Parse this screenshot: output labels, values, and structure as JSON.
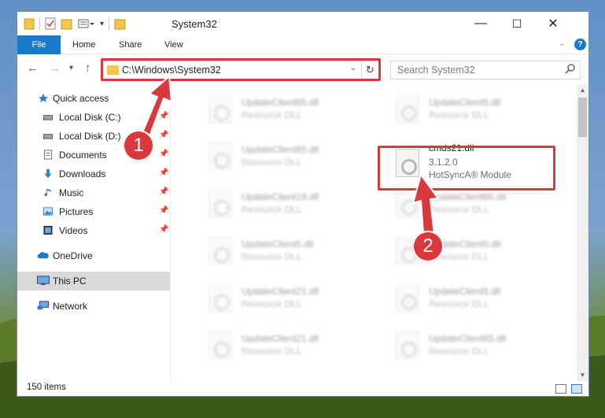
{
  "window": {
    "title": "System32",
    "minimize": "—",
    "maximize": "☐",
    "close": "✕"
  },
  "ribbon": {
    "tabs": [
      "File",
      "Home",
      "Share",
      "View"
    ],
    "help": "?"
  },
  "navigation": {
    "address": "C:\\Windows\\System32",
    "search_placeholder": "Search System32"
  },
  "sidebar": {
    "items": [
      {
        "label": "Quick access",
        "icon": "star-icon"
      },
      {
        "label": "Local Disk (C:)",
        "icon": "drive-icon",
        "pinned": true
      },
      {
        "label": "Local Disk (D:)",
        "icon": "drive-icon",
        "pinned": true
      },
      {
        "label": "Documents",
        "icon": "documents-icon",
        "pinned": true
      },
      {
        "label": "Downloads",
        "icon": "download-icon",
        "pinned": true
      },
      {
        "label": "Music",
        "icon": "music-icon",
        "pinned": true
      },
      {
        "label": "Pictures",
        "icon": "pictures-icon",
        "pinned": true
      },
      {
        "label": "Videos",
        "icon": "videos-icon",
        "pinned": true
      },
      {
        "label": "OneDrive",
        "icon": "cloud-icon"
      },
      {
        "label": "This PC",
        "icon": "computer-icon",
        "selected": true
      },
      {
        "label": "Network",
        "icon": "network-icon"
      }
    ]
  },
  "files": {
    "left_column": [
      {
        "name": "UpdateClient65.dll",
        "type": "Resource DLL"
      },
      {
        "name": "UpdateClient65.dll",
        "type": "Resource DLL"
      },
      {
        "name": "UpdateClient19.dll",
        "type": "Resource DLL"
      },
      {
        "name": "UpdateClient5.dll",
        "type": "Resource DLL"
      },
      {
        "name": "UpdateClient21.dll",
        "type": "Resource DLL"
      },
      {
        "name": "UpdateClient21.dll",
        "type": "Resource DLL"
      }
    ],
    "right_column": [
      {
        "name": "UpdateClient5.dll",
        "type": "Resource DLL"
      },
      {
        "name": "cmds21.dll",
        "version": "3.1.2.0",
        "type": "HotSyncA® Module",
        "highlighted": true
      },
      {
        "name": "UpdateClient65.dll",
        "type": "Resource DLL"
      },
      {
        "name": "UpdateClient5.dll",
        "type": "Resource DLL"
      },
      {
        "name": "UpdateClient5.dll",
        "type": "Resource DLL"
      },
      {
        "name": "UpdateClient65.dll",
        "type": "Resource DLL"
      }
    ]
  },
  "status": {
    "item_count": "150 items"
  },
  "callouts": {
    "step1": "1",
    "step2": "2",
    "color": "#d9393d"
  }
}
